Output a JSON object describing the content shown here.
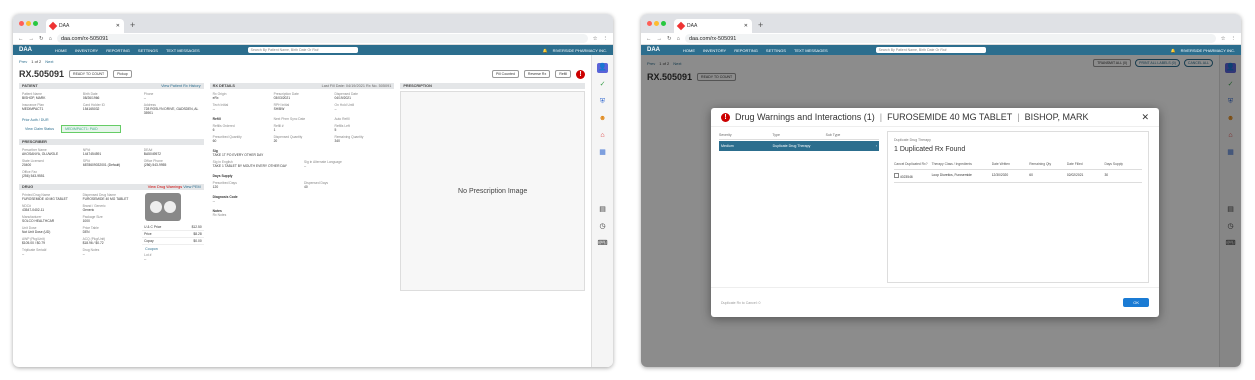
{
  "browser": {
    "tab_title": "DAA",
    "url": "daa.com/rx-505091"
  },
  "nav": {
    "logo": "DAA",
    "items": [
      "HOME",
      "INVENTORY",
      "REPORTING",
      "SETTINGS",
      "TEXT MESSAGES"
    ],
    "search": "Search By Patient Name, Birth Date Or Rx#",
    "pharmacy": "RIVERSIDE PHARMACY INC."
  },
  "page": {
    "prev": "Prev",
    "pager": "1 of 2",
    "next": "Next",
    "transmit": "TRANSMIT ALL (0)",
    "print_all": "PRINT ALL LABELS (0)",
    "cancel_all": "CANCEL ALL",
    "rx_number": "RX.505091",
    "ready": "READY TO COUNT",
    "priority_label": "Rx Priority",
    "priority": "Pickup",
    "pill_counted": "Pill Counted",
    "reverse": "Reverse Rx",
    "refill": "Refill"
  },
  "patient": {
    "header": "PATIENT",
    "history": "View Patient Rx History",
    "name_l": "Patient Name",
    "name": "BISHOP, MARK",
    "dob_l": "Birth Date",
    "dob": "08/26/1966",
    "phone_l": "Phone",
    "phone": "--",
    "plan_l": "Insurance Plan",
    "plan": "MEDIMPACT1",
    "card_l": "Card Holder ID",
    "card": "154165032",
    "addr_l": "Address",
    "addr": "728 ROSLYN DRIVE, GADSDEN, AL 35901",
    "prior": "Prior Auth / DUR",
    "claim": "View Claim Status",
    "claim_tag": "MEDIMPACT1: PAID"
  },
  "prescriber": {
    "header": "PRESCRIBER",
    "name_l": "Prescriber Name",
    "name": "AKOSANYA, OLUWOLE",
    "npi_l": "NPI#",
    "npi": "1447454591",
    "dea_l": "DEA#",
    "dea": "BA5049572",
    "state_l": "State Licensed",
    "state": "20400",
    "spi_l": "SPI#",
    "spi": "6878609032001 (Default)",
    "office_l": "Office Phone",
    "office": "(256) 543-9955",
    "fax_l": "Office Fax",
    "fax": "(256) 543-9551"
  },
  "drug": {
    "header": "DRUG",
    "warnings": "View Drug Warnings",
    "pem": "View PEM",
    "printed_l": "Printed Drug Name",
    "printed": "FUROSEMIDE 40 MG TABLET",
    "disp_l": "Dispensed Drug Name",
    "disp": "FUROSEMIDE 40 MG TABLET",
    "ndc_l": "NDC#",
    "ndc": "43547-0402-11",
    "brand_l": "Brand / Generic",
    "brand": "Generic",
    "mfr_l": "Manufacturer",
    "mfr": "SOLCO HEALTHCAR",
    "pkg_l": "Package Size",
    "pkg": "1000",
    "unit_l": "Unit Dose",
    "unit": "Not Unit Dose (UD)",
    "table_l": "Price Table",
    "table": "DEN",
    "awp_l": "AWP (Pkg/Unit)",
    "awp": "$105.00 / $0.79",
    "acq_l": "ACQ (Pkg/Unit)",
    "acq": "$18.96 / $0.72",
    "trip_l": "Triplicate Serial#",
    "trip": "--",
    "notes_l": "Drug Notes",
    "notes": "--",
    "uc_l": "U & C Price",
    "uc": "$12.50",
    "price_l": "Price",
    "price": "$8.28",
    "copay_l": "Copay",
    "copay": "$0.00",
    "coupon": "Coupon",
    "lot_l": "Lot #",
    "lot": "--"
  },
  "rxdetails": {
    "header": "RX DETAILS",
    "last_fill": "Last Fill Date: 04/19/2021",
    "rx_no": "Rx No. 505091",
    "origin_l": "Rx Origin",
    "origin": "eRx",
    "presc_date_l": "Prescription Date",
    "presc_date": "03/03/2021",
    "disp_date_l": "Dispensed Date",
    "disp_date": "04/19/2021",
    "tech_l": "Tech Initial",
    "tech": "--",
    "rph_l": "RPH Initial",
    "rph": "SH/BW",
    "hold_l": "On Hold Until",
    "hold": "--",
    "refill_l": "Refill",
    "next_sync": "Next Phrm Sync Date",
    "auto": "Auto Refill",
    "rem_l": "Refills Ordered",
    "rem": "6",
    "refnum_l": "Refill #",
    "refnum": "1",
    "left_l": "Refills Left",
    "left": "5",
    "pq_l": "Prescribed Quantity",
    "pq": "60",
    "dq_l": "Dispensed Quantity",
    "dq": "20",
    "rq_l": "Remaining Quantity",
    "rq": "340",
    "sig_l": "Sig",
    "sig": "TAKE 1T PO EVERY OTHER DAY",
    "sige_l": "Sig in English",
    "sige": "TAKE 1 TABLET BY MOUTH EVERY OTHER DAY",
    "siga_l": "Sig in Alternate Language",
    "siga": "--",
    "ds_l": "Days Supply",
    "psup_l": "Prescribed Days",
    "psup": "120",
    "dsup_l": "Dispensed Days",
    "dsup": "40",
    "dx_l": "Diagnosis Code",
    "dx": "--",
    "notes_l": "Notes",
    "notes": "Rx Notes"
  },
  "prescription": {
    "header": "PRESCRIPTION",
    "no_image": "No Prescription Image"
  },
  "modal": {
    "title": "Drug Warnings and Interactions (1)",
    "drug": "FUROSEMIDE 40 MG TABLET",
    "patient": "BISHOP, MARK",
    "col_sev": "Severity",
    "col_type": "Type",
    "col_sub": "Sub Type",
    "sev": "Medium",
    "type": "Duplicate Drug Therapy",
    "right_sub": "Duplicate Drug Therapy",
    "right_big": "1 Duplicated Rx Found",
    "h1": "Cancel Duplicated Rx?",
    "h2": "Therapy Class / Ingredients",
    "h3": "Date Written",
    "h4": "Remaining Qty",
    "h5": "Date Filled",
    "h6": "Days Supply",
    "r_rx": "4023546",
    "r_class": "Loop Diuretics, Furosemide",
    "r_written": "12/30/2020",
    "r_rem": "60",
    "r_filled": "02/02/2021",
    "r_days": "30",
    "foot": "Duplicate Rx to Cancel: 0",
    "ok": "OK"
  },
  "colors": {
    "nav": "#2c6e8e",
    "accent": "#2c6e8e",
    "warn": "#cc0000",
    "ok": "#1a7bd4"
  }
}
